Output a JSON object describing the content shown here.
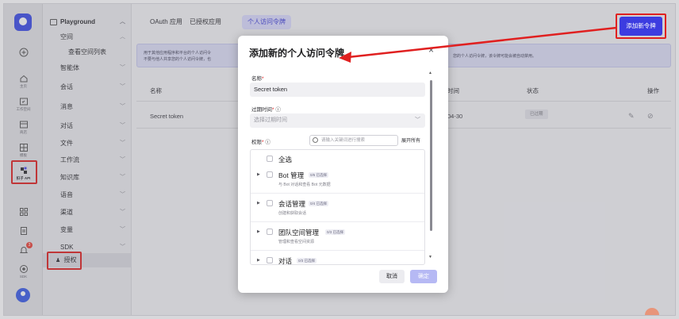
{
  "rail": {
    "items": [
      {
        "label": ""
      },
      {
        "label": "主页"
      },
      {
        "label": "工作空间"
      },
      {
        "label": "商店"
      },
      {
        "label": "模板"
      },
      {
        "label": "扣子 API"
      },
      {
        "label": "SDK"
      }
    ],
    "notification_count": "3"
  },
  "nav": {
    "items": [
      {
        "label": "Playground"
      },
      {
        "label": "空间"
      },
      {
        "label": "查看空间列表"
      },
      {
        "label": "智能体"
      },
      {
        "label": "会话"
      },
      {
        "label": "消息"
      },
      {
        "label": "对话"
      },
      {
        "label": "文件"
      },
      {
        "label": "工作流"
      },
      {
        "label": "知识库"
      },
      {
        "label": "语音"
      },
      {
        "label": "渠道"
      },
      {
        "label": "变量"
      },
      {
        "label": "SDK"
      },
      {
        "label": "授权"
      }
    ]
  },
  "tabs": [
    {
      "label": "OAuth 应用"
    },
    {
      "label": "已授权应用"
    },
    {
      "label": "个人访问令牌"
    }
  ],
  "add_button": "添加新令牌",
  "notice": {
    "line1": "用于其他应用程序和平台的个人访问令",
    "line2": "不要与他人共享您的个人访问令牌，也",
    "line_right": "您的个人访问令牌，该令牌可能会被自动禁用。"
  },
  "table": {
    "headers": {
      "name": "名称",
      "expires": "时间",
      "status": "状态",
      "actions": "操作"
    },
    "row": {
      "name": "Secret token",
      "expires": "04-30",
      "status": "已过期"
    }
  },
  "modal": {
    "title": "添加新的个人访问令牌",
    "close": "×",
    "name_label": "名称",
    "name_value": "Secret token",
    "expiry_label": "过期时间",
    "expiry_placeholder": "选择过期时间",
    "perm_label": "权限",
    "search_placeholder": "请输入关键词进行搜索",
    "expand_all": "展开所有",
    "select_all": "全选",
    "permissions": [
      {
        "name": "Bot 管理",
        "tag": "0/6 已选择",
        "desc": "与 Bot 对话和查看 Bot 元数据"
      },
      {
        "name": "会话管理",
        "tag": "0/4 已选择",
        "desc": "创建和获取会话"
      },
      {
        "name": "团队空间管理",
        "tag": "0/3 已选择",
        "desc": "管理和查看空间资源"
      },
      {
        "name": "对话",
        "tag": "0/3 已选择",
        "desc": ""
      }
    ],
    "cancel": "取消",
    "confirm": "确定"
  }
}
